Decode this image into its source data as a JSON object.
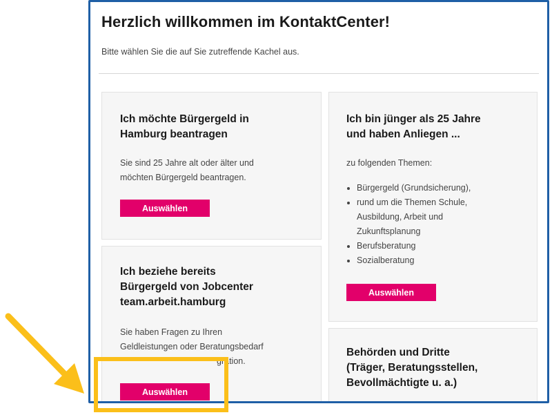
{
  "header": {
    "title": "Herzlich willkommen im KontaktCenter!",
    "subtitle": "Bitte wählen Sie die auf Sie zutreffende Kachel aus."
  },
  "tiles": [
    {
      "title_line1": "Ich möchte Bürgergeld in",
      "title_line2": "Hamburg beantragen",
      "text_line1": "Sie sind 25 Jahre alt oder älter und",
      "text_line2": "möchten Bürgergeld beantragen.",
      "button": "Auswählen"
    },
    {
      "title_line1": "Ich bin jünger als 25 Jahre",
      "title_line2": "und haben Anliegen ...",
      "intro": "zu folgenden Themen:",
      "items": [
        "Bürgergeld (Grundsicherung),",
        "rund um die Themen Schule,",
        "Ausbildung, Arbeit und",
        "Zukunftsplanung",
        "Berufsberatung",
        "Sozialberatung"
      ],
      "button": "Auswählen"
    },
    {
      "title_line1": "Ich beziehe bereits",
      "title_line2": "Bürgergeld von Jobcenter",
      "title_line3": "team.arbeit.hamburg",
      "text_line1": "Sie haben Fragen zu Ihren",
      "text_line2": "Geldleistungen oder Beratungsbedarf",
      "text_line3": "gration.",
      "button": "Auswählen"
    },
    {
      "title_line1": "Behörden und Dritte",
      "title_line2": "(Träger, Beratungsstellen,",
      "title_line3": "Bevollmächtigte u. a.)"
    }
  ],
  "colors": {
    "frame_border": "#1f5fa6",
    "button": "#e2006a",
    "annotation": "#fbbf1a",
    "tile_bg": "#f6f6f6"
  },
  "annotation": {
    "arrow_icon": "arrow-down-right-icon",
    "highlight": "highlight-box"
  }
}
